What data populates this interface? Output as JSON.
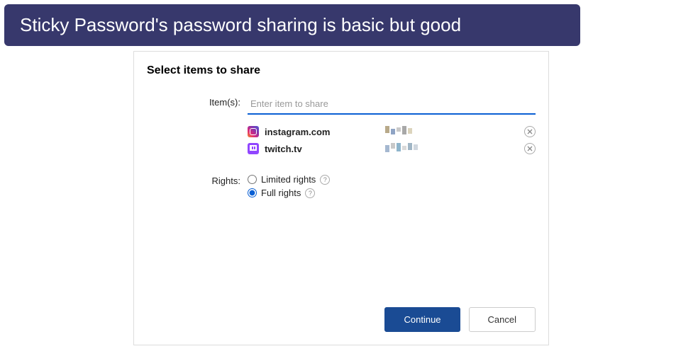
{
  "banner": {
    "text": "Sticky Password's password sharing is basic but good"
  },
  "dialog": {
    "title": "Select items to share",
    "items_label": "Item(s):",
    "items_placeholder": "Enter item to share",
    "items": [
      {
        "icon": "instagram",
        "domain": "instagram.com"
      },
      {
        "icon": "twitch",
        "domain": "twitch.tv"
      }
    ],
    "rights_label": "Rights:",
    "rights_options": {
      "limited": "Limited rights",
      "full": "Full rights"
    },
    "rights_selected": "full",
    "buttons": {
      "continue": "Continue",
      "cancel": "Cancel"
    }
  }
}
